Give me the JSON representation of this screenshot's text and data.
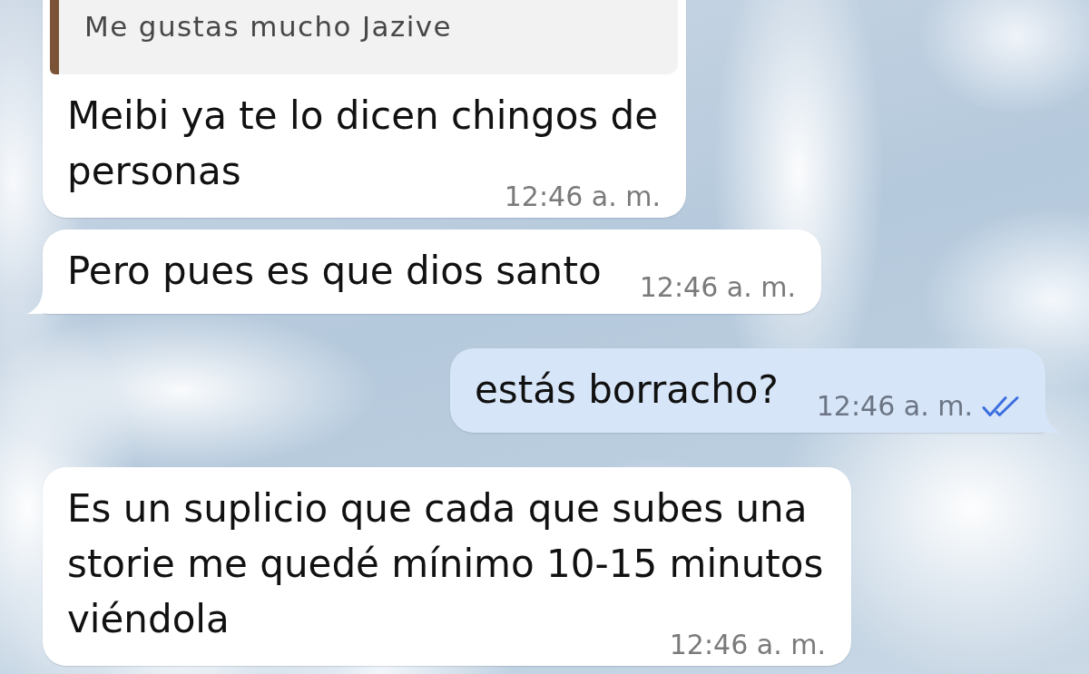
{
  "messages": [
    {
      "kind": "incoming",
      "reply_quote": {
        "text": "Me gustas mucho Jazive"
      },
      "text": "Meibi ya te lo dicen chingos de personas",
      "time": "12:46 a. m.",
      "tail": false
    },
    {
      "kind": "incoming",
      "text": "Pero pues es que dios santo",
      "time": "12:46 a. m.",
      "tail": true
    },
    {
      "kind": "outgoing",
      "text": "estás borracho?",
      "time": "12:46 a. m.",
      "read": true,
      "tail": true
    },
    {
      "kind": "incoming",
      "text": "Es un suplicio que cada que subes una storie me quedé mínimo 10-15 minutos viéndola",
      "time": "12:46 a. m.",
      "tail": false
    }
  ]
}
